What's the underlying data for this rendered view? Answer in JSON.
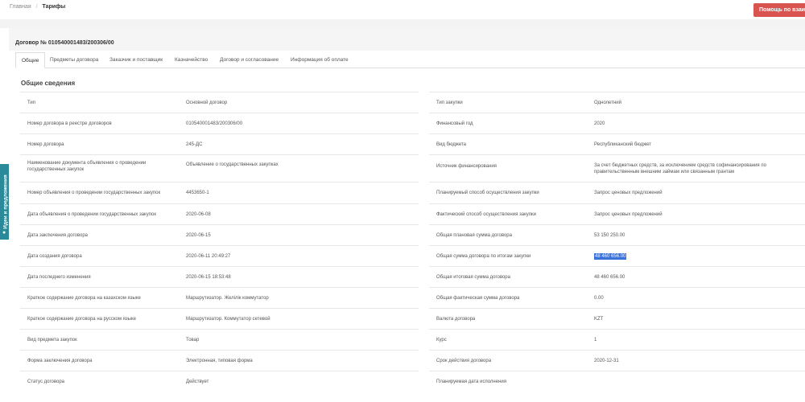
{
  "breadcrumb": {
    "home": "Главная",
    "separator": "/",
    "current": "Тарифы"
  },
  "help_button": "Помощь по взаимо",
  "side_tab": {
    "label": "Идеи и предложения",
    "icon": "lightbulb-icon"
  },
  "contract_title": "Договор № 010540001483/200306/00",
  "tabs": [
    "Общие",
    "Предметы договора",
    "Заказчик и поставщик",
    "Казначейство",
    "Договор и согласование",
    "Информация об оплате"
  ],
  "section_title": "Общие сведения",
  "left_rows": [
    {
      "label": "Тип",
      "value": "Основной договор"
    },
    {
      "label": "Номер договора в реестре договоров",
      "value": "010540001483/200306/00"
    },
    {
      "label": "Номер договора",
      "value": "245-ДС"
    },
    {
      "label": "Наименование документа объявления о проведении государственных закупок",
      "value": "Объявление о государственных закупках"
    },
    {
      "label": "Номер объявления о проведении государственных закупок",
      "value": "4453650-1"
    },
    {
      "label": "Дата объявления о проведении государственных закупок",
      "value": "2020-06-08"
    },
    {
      "label": "Дата заключения договора",
      "value": "2020-06-15"
    },
    {
      "label": "Дата создания договора",
      "value": "2020-06-11 20:49:27"
    },
    {
      "label": "Дата последнего изменения",
      "value": "2020-06-15 18:53:48"
    },
    {
      "label": "Краткое содержание договора на казахском языке",
      "value": "Маршрутизатор. Желілік коммутатор"
    },
    {
      "label": "Краткое содержание договора на русском языке",
      "value": "Маршрутизатор. Коммутатор сетевой"
    },
    {
      "label": "Вид предмета закупок",
      "value": "Товар"
    },
    {
      "label": "Форма заключения договора",
      "value": "Электронная, типовая форма"
    },
    {
      "label": "Статус договора",
      "value": "Действует"
    }
  ],
  "right_rows": [
    {
      "label": "Тип закупки",
      "value": "Однолетний"
    },
    {
      "label": "Финансовый год",
      "value": "2020"
    },
    {
      "label": "Вид бюджета",
      "value": "Республиканский бюджет"
    },
    {
      "label": "Источник финансирования",
      "value": "За счет бюджетных средств, за исключением средств софинансирования по правительственным внешним займам или связанным грантам"
    },
    {
      "label": "Планируемый способ осуществления закупки",
      "value": "Запрос ценовых предложений"
    },
    {
      "label": "Фактический способ осуществления закупки",
      "value": "Запрос ценовых предложений"
    },
    {
      "label": "Общая плановая сумма договора",
      "value": "53 150 250.00"
    },
    {
      "label": "Общая сумма договора по итогам закупки",
      "value": "48 460 656.00",
      "highlighted": true
    },
    {
      "label": "Общая итоговая сумма договора",
      "value": "48 460 656.00"
    },
    {
      "label": "Общая фактическая сумма договора",
      "value": "0.00"
    },
    {
      "label": "Валюта договора",
      "value": "KZT"
    },
    {
      "label": "Курс",
      "value": "1"
    },
    {
      "label": "Срок действия договора",
      "value": "2020-12-31"
    },
    {
      "label": "Планируемая дата исполнения",
      "value": ""
    }
  ]
}
